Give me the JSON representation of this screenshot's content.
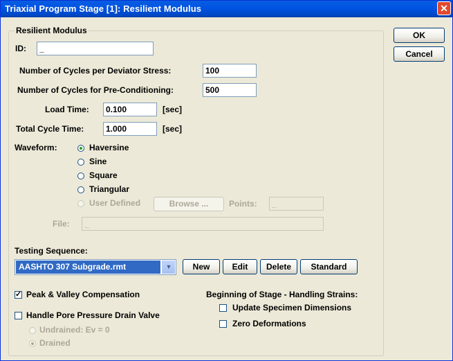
{
  "window": {
    "title": "Triaxial Program Stage [1]: Resilient Modulus",
    "close_glyph": "✕"
  },
  "buttons": {
    "ok": "OK",
    "cancel": "Cancel"
  },
  "group": {
    "title": "Resilient Modulus"
  },
  "id": {
    "label": "ID:",
    "value": "_"
  },
  "cycles_deviator": {
    "label": "Number of Cycles per Deviator Stress:",
    "value": "100"
  },
  "cycles_preconditioning": {
    "label": "Number of Cycles for Pre-Conditioning:",
    "value": "500"
  },
  "load_time": {
    "label": "Load Time:",
    "value": "0.100",
    "unit": "[sec]"
  },
  "total_cycle_time": {
    "label": "Total Cycle Time:",
    "value": "1.000",
    "unit": "[sec]"
  },
  "waveform": {
    "label": "Waveform:",
    "options": [
      "Haversine",
      "Sine",
      "Square",
      "Triangular",
      "User Defined"
    ],
    "selected": "Haversine",
    "browse_label": "Browse ...",
    "points_label": "Points:",
    "points_value": "_"
  },
  "file": {
    "label": "File:",
    "value": "_"
  },
  "testing_sequence": {
    "label": "Testing Sequence:",
    "selected": "AASHTO 307 Subgrade.rmt",
    "arrow": "▼",
    "new_label": "New",
    "edit_label": "Edit",
    "delete_label": "Delete",
    "standard_label": "Standard"
  },
  "peak_valley": {
    "label": "Peak & Valley Compensation",
    "checked": true,
    "mark": "✓"
  },
  "pore_pressure": {
    "label": "Handle Pore Pressure Drain Valve",
    "checked": false,
    "undrained_label": "Undrained:  Ev = 0",
    "drained_label": "Drained"
  },
  "beginning_stage": {
    "label": "Beginning of Stage - Handling Strains:",
    "update_dimensions_label": "Update Specimen Dimensions",
    "zero_deformations_label": "Zero Deformations"
  },
  "colors": {
    "titlebar": "#0054e3",
    "dialog_bg": "#ece9d8",
    "selection": "#316ac5",
    "close": "#e04a2e"
  }
}
